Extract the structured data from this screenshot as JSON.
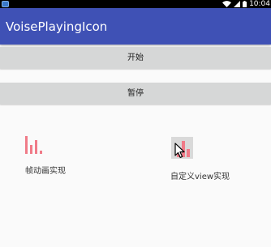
{
  "status_bar": {
    "time": "10:04",
    "icons": [
      "app-notification-icon",
      "wifi-icon",
      "signal-icon",
      "battery-icon"
    ]
  },
  "action_bar": {
    "title": "VoisePlayingIcon"
  },
  "buttons": {
    "start_label": "开始",
    "pause_label": "暂停"
  },
  "demos": {
    "frame_animation_label": "帧动画实现",
    "custom_view_label": "自定义view实现"
  },
  "colors": {
    "action_bar": "#3f51b5",
    "status_bar": "#000000",
    "button_bg": "#d6d7d7",
    "bars": "#f07b88",
    "custom_box_bg": "#d9d9d9"
  }
}
